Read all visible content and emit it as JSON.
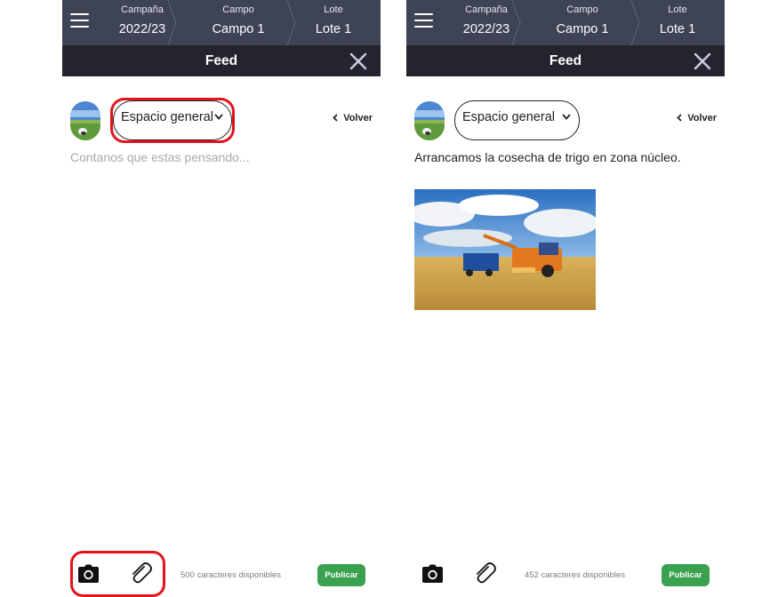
{
  "panels": [
    {
      "header": {
        "breadcrumbs": [
          {
            "label": "Campaña",
            "value": "2022/23"
          },
          {
            "label": "Campo",
            "value": "Campo 1"
          },
          {
            "label": "Lote",
            "value": "Lote 1"
          }
        ],
        "title": "Feed"
      },
      "composer": {
        "space_selector": "Espacio general",
        "back_label": "Volver",
        "placeholder": "Contanos que estas pensando...",
        "text": ""
      },
      "footer": {
        "char_count": "500 caracteres disponibles",
        "publish_label": "Publicar"
      }
    },
    {
      "header": {
        "breadcrumbs": [
          {
            "label": "Campaña",
            "value": "2022/23"
          },
          {
            "label": "Campo",
            "value": "Campo 1"
          },
          {
            "label": "Lote",
            "value": "Lote 1"
          }
        ],
        "title": "Feed"
      },
      "composer": {
        "space_selector": "Espacio general",
        "back_label": "Volver",
        "text": "Arrancamos la cosecha de trigo en zona núcleo.",
        "attached_image": "harvest-photo"
      },
      "footer": {
        "char_count": "452 caracteres disponibles",
        "publish_label": "Publicar"
      }
    }
  ],
  "colors": {
    "header_bg": "#3f4356",
    "subheader_bg": "#23242e",
    "publish_bg": "#3aa14e",
    "highlight": "#e3141c",
    "placeholder": "#a7a9ad"
  },
  "icons": [
    "menu-icon",
    "close-icon",
    "chevron-down-icon",
    "chevron-left-icon",
    "camera-icon",
    "paperclip-icon"
  ]
}
